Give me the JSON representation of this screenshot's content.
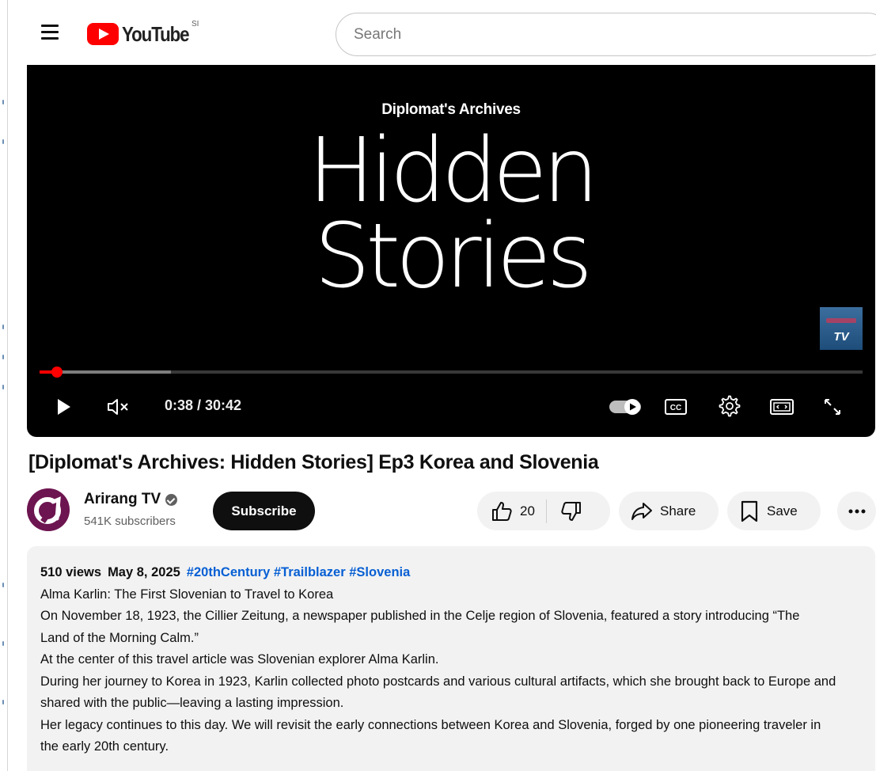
{
  "header": {
    "logo_text": "YouTube",
    "region_code": "SI",
    "search_placeholder": "Search"
  },
  "player": {
    "brand_subtitle": "Diplomat's Archives",
    "brand_title_line1": "Hidden",
    "brand_title_line2": "Stories",
    "watermark_text": "TV",
    "time_display": "0:38 / 30:42",
    "played_fraction": 0.021,
    "buffered_fraction": 0.16
  },
  "video": {
    "title": "[Diplomat's Archives: Hidden Stories] Ep3 Korea and Slovenia"
  },
  "channel": {
    "name": "Arirang TV",
    "subscribers": "541K subscribers",
    "subscribe_label": "Subscribe"
  },
  "actions": {
    "like_count": "20",
    "share_label": "Share",
    "save_label": "Save"
  },
  "description": {
    "views": "510 views",
    "date": "May 8, 2025",
    "hashtags": [
      "#20thCentury",
      "#Trailblazer",
      "#Slovenia"
    ],
    "lines": [
      "Alma Karlin: The First Slovenian to Travel to Korea",
      "On November 18, 1923, the Cillier Zeitung, a newspaper published in the Celje region of Slovenia, featured a story introducing “The Land of the Morning Calm.”",
      "At the center of this travel article was Slovenian explorer Alma Karlin.",
      "During her journey to Korea in 1923, Karlin collected photo postcards and various cultural artifacts, which she brought back to Europe and shared with the public—leaving a lasting impression.",
      "Her legacy continues to this day. We will revisit the early connections between Korea and Slovenia, forged by one pioneering traveler in the early 20th century."
    ]
  },
  "colors": {
    "brand_red": "#ff0000",
    "link_blue": "#065fd4",
    "pill_bg": "#f2f2f2",
    "subscribe_bg": "#0f0f0f"
  }
}
